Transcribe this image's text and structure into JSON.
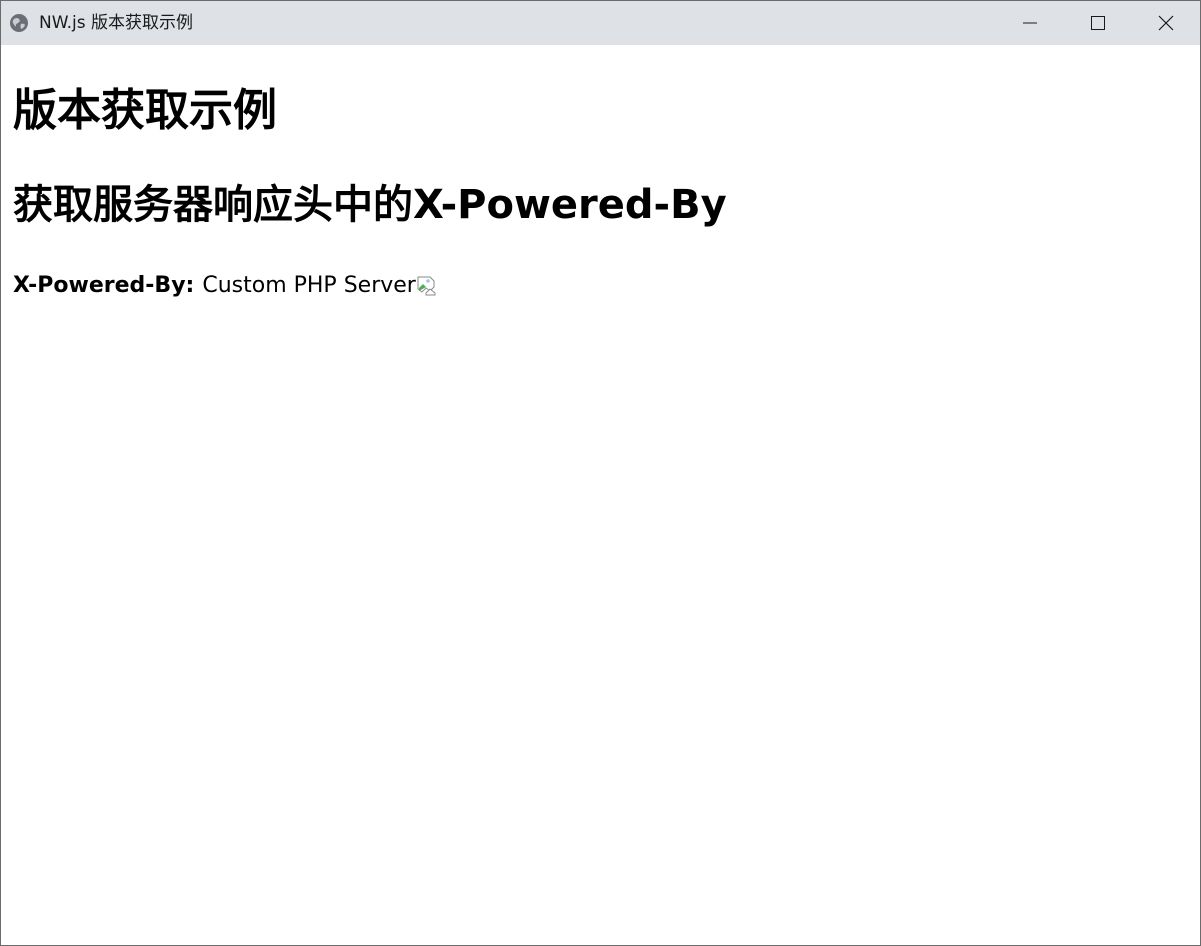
{
  "window": {
    "title": "NW.js 版本获取示例",
    "icon": "globe-icon",
    "controls": [
      "minimize-icon",
      "maximize-icon",
      "close-icon"
    ]
  },
  "content": {
    "heading": "版本获取示例",
    "subheading": "获取服务器响应头中的X-Powered-By",
    "header_label": "X-Powered-By:",
    "header_value": "Custom PHP Server",
    "image": "broken-image-icon"
  },
  "colors": {
    "titlebar": "#dee1e6",
    "background": "#ffffff",
    "text": "#000000"
  }
}
